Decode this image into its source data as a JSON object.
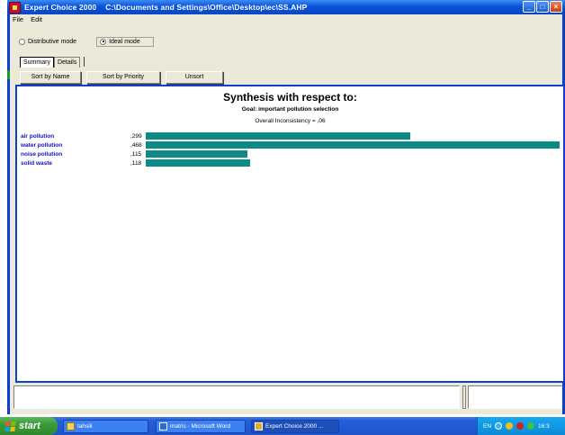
{
  "window": {
    "app_name": "Expert Choice 2000",
    "file_path": "C:\\Documents and Settings\\Office\\Desktop\\ec\\SS.AHP"
  },
  "menu": [
    "File",
    "Edit"
  ],
  "modes": {
    "distributive": "Distributive mode",
    "ideal": "Ideal mode",
    "selected": "ideal"
  },
  "tabs": [
    {
      "label": "Summary",
      "active": true
    },
    {
      "label": "Details",
      "active": false
    }
  ],
  "buttons": {
    "sort_by_name": "Sort by Name",
    "sort_by_priority": "Sort by Priority",
    "unsort": "Unsort"
  },
  "synthesis": {
    "title": "Synthesis with respect to:",
    "goal": "Goal: important pollution selection",
    "inconsistency": "Overall Inconsistency = ,06"
  },
  "chart_data": {
    "type": "bar",
    "orientation": "horizontal",
    "categories": [
      "air pollution",
      "water pollution",
      "noise pollution",
      "solid waste"
    ],
    "values": [
      0.299,
      0.468,
      0.115,
      0.118
    ],
    "value_labels": [
      ",299",
      ",468",
      ",115",
      ",118"
    ],
    "bar_color": "#0c8a86",
    "label_color": "#1010d0"
  },
  "taskbar": {
    "start": "start",
    "tasks": [
      "tahsili",
      "matris - Microsoft Word",
      "Expert Choice 2000 ..."
    ],
    "tray": {
      "lang": "EN",
      "clock": "16:3"
    }
  }
}
